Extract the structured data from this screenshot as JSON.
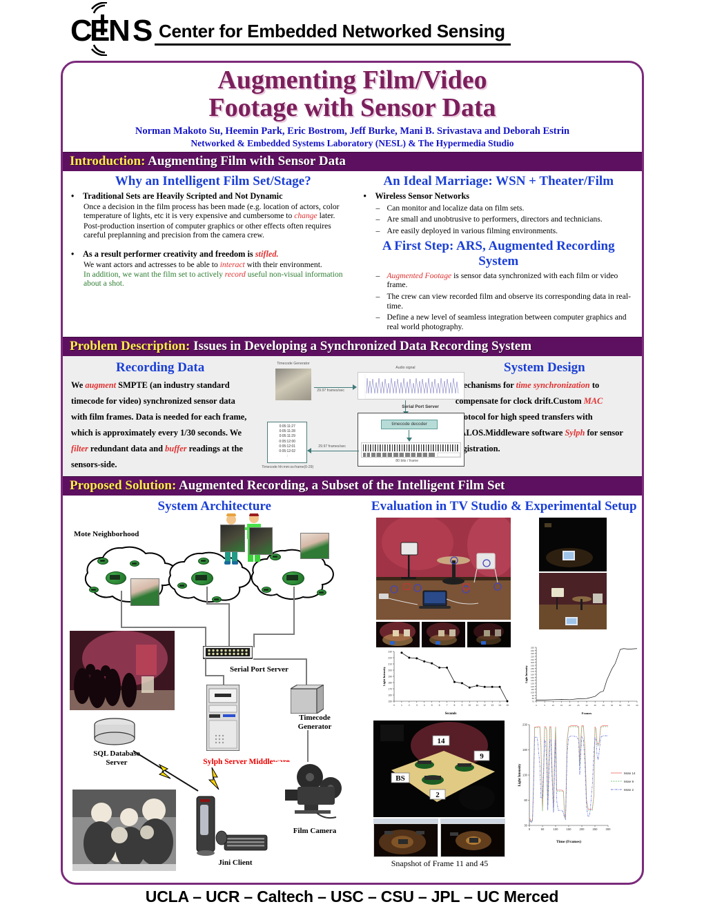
{
  "header": {
    "logo_text": "CENS",
    "title": "Center for Embedded Networked Sensing"
  },
  "poster": {
    "title_line1": "Augmenting Film/Video",
    "title_line2": "Footage with Sensor Data",
    "authors": "Norman Makoto Su, Heemin Park, Eric Bostrom, Jeff Burke, Mani B. Srivastava and Deborah Estrin",
    "affiliation": "Networked & Embedded Systems Laboratory (NESL) & The Hypermedia Studio"
  },
  "introduction": {
    "bar_key": "Introduction:",
    "bar_rest": " Augmenting Film with Sensor Data",
    "left": {
      "subhead": "Why an Intelligent Film Set/Stage?",
      "bullet1": "Traditional Sets are Heavily Scripted and Not Dynamic",
      "bullet1_p1_a": "Once a decision in the film process has been made (e.g. location of actors, color temperature of lights, etc it is very expensive and cumbersome to ",
      "bullet1_p1_em": "change",
      "bullet1_p1_b": " later.",
      "bullet1_p2": "Post-production insertion of computer graphics or other effects often requires careful preplanning and precision from the camera crew.",
      "bullet2_a": "As a result performer creativity and freedom is ",
      "bullet2_em": "stifled.",
      "bullet2_p1_a": "We want actors and actresses to be able to ",
      "bullet2_p1_em": "interact",
      "bullet2_p1_b": " with their environment.",
      "bullet2_p2_a": "In addition, we want the film set to actively ",
      "bullet2_p2_em": "record",
      "bullet2_p2_b": " useful non-visual information about a shot."
    },
    "right": {
      "subhead": "An Ideal Marriage: WSN + Theater/Film",
      "bullet": "Wireless Sensor Networks",
      "items": [
        "Can monitor and localize data on film sets.",
        "Are small and unobtrusive to performers, directors and technicians.",
        "Are easily deployed in various filming environments."
      ],
      "subhead2": "A First Step: ARS, Augmented Recording System",
      "items2_em": "Augmented Footage",
      "items2_first_rest": " is sensor data synchronized with each film or video frame.",
      "items2": [
        "The crew can view recorded film and observe its corresponding data in real-time.",
        "Define a new level of seamless integration between computer graphics and real world photography."
      ]
    }
  },
  "problem": {
    "bar_key": "Problem Description:",
    "bar_rest": " Issues in Developing a Synchronized Data Recording System",
    "left": {
      "subhead": "Recording Data",
      "t1": "We ",
      "em1": "augment",
      "t2": " SMPTE (an industry standard timecode for video) synchronized sensor data with film frames.  Data is needed for each frame, which is approximately every 1/30 seconds.  We ",
      "em2": "filter",
      "t3": " redundant data and ",
      "em3": "buffer",
      "t4": " readings at the sensors-side."
    },
    "diagram": {
      "timecode_generator": "Timecode Generator",
      "audio_signal": "Audio signal",
      "serial_port_server": "Serial Port Server",
      "timecode_decoder": "timecode decoder",
      "rate_label_top": "29.97 frames/sec",
      "rate_label_bottom": "29.97 frames/sec",
      "bits_label": "80 bits / frame",
      "codes": [
        "0:05:11:27",
        "0:05:11:28",
        "0:05:11:29",
        "0:05:12:00",
        "0:05:12:01",
        "0:05:12:02",
        ":"
      ],
      "codes_caption": "Timecode    hh:mm:ss:frame(0-29)"
    },
    "right": {
      "subhead": "System Design",
      "t1": "Mechanisms for ",
      "em1": "time synchronization",
      "t2": " to compensate for clock drift.",
      "t3": "Custom ",
      "em2": "MAC",
      "t4": " protocol for high speed transfers with PALOS.",
      "t5": "Middleware software ",
      "em3": "Sylph",
      "t6": " for sensor registration."
    }
  },
  "solution": {
    "bar_key": "Proposed Solution:",
    "bar_rest": " Augmented Recording, a Subset of the Intelligent Film Set",
    "arch_subhead": "System Architecture",
    "eval_subhead": "Evaluation in TV Studio & Experimental Setup",
    "labels": {
      "mote_neighborhood": "Mote Neighborhood",
      "serial_port_server": "Serial Port Server",
      "sql_database_server": "SQL Database\nServer",
      "sylph_server_middleware": "Sylph Server Middleware",
      "timecode_generator": "Timecode\nGenerator",
      "film_camera": "Film Camera",
      "jini_client": "Jini Client"
    },
    "photo_markers": [
      "14",
      "9",
      "BS",
      "2"
    ],
    "snapshot_caption": "Snapshot of Frame 11 and 45"
  },
  "chart_data": [
    {
      "type": "line",
      "title": "",
      "xlabel": "Seconds",
      "ylabel": "Light Intensity",
      "x": [
        1,
        2,
        3,
        4,
        5,
        6,
        7,
        8,
        9,
        10,
        11,
        12,
        13,
        14,
        15
      ],
      "values": [
        228,
        220,
        219,
        214,
        211,
        204,
        204,
        181,
        179,
        172,
        175,
        173,
        173,
        173,
        150
      ],
      "xlim": [
        0,
        15
      ],
      "ylim": [
        150,
        230
      ],
      "xticks": [
        0,
        1,
        2,
        3,
        4,
        5,
        6,
        7,
        8,
        9,
        10,
        11,
        12,
        13,
        14,
        15
      ],
      "yticks": [
        150,
        160,
        170,
        180,
        190,
        200,
        210,
        220,
        230
      ],
      "grid": false,
      "legend": "none"
    },
    {
      "type": "line",
      "title": "",
      "xlabel": "Frames",
      "ylabel": "Light Intensity",
      "x": [
        0,
        5,
        10,
        15,
        20,
        25,
        30,
        35,
        38,
        40,
        42,
        45,
        47,
        50,
        52,
        55,
        60
      ],
      "values": [
        74,
        74,
        75,
        76,
        75,
        78,
        79,
        86,
        100,
        104,
        140,
        178,
        196,
        243,
        246,
        244,
        246
      ],
      "xlim": [
        0,
        60
      ],
      "ylim": [
        70,
        250
      ],
      "xticks": [
        0,
        5,
        10,
        15,
        20,
        25,
        30,
        35,
        40,
        45,
        50,
        55,
        60
      ],
      "yticks": [
        70,
        80,
        90,
        100,
        110,
        120,
        130,
        140,
        150,
        160,
        170,
        180,
        190,
        200,
        210,
        220,
        230,
        240,
        250
      ],
      "grid": false,
      "legend": "none"
    },
    {
      "type": "line",
      "title": "",
      "xlabel": "Time (Frames)",
      "ylabel": "Light Intensity",
      "xlim": [
        0,
        300
      ],
      "ylim": [
        30,
        230
      ],
      "xticks": [
        0,
        50,
        100,
        150,
        200,
        250,
        300
      ],
      "yticks": [
        30,
        80,
        130,
        180,
        230
      ],
      "grid": false,
      "legend": "right",
      "series": [
        {
          "name": "Mote 14",
          "color": "#f08080",
          "x": [
            0,
            8,
            12,
            16,
            20,
            34,
            40,
            44,
            50,
            54,
            58,
            62,
            66,
            70,
            74,
            78,
            82,
            86,
            92,
            96,
            100,
            104,
            110,
            118,
            124,
            130,
            134,
            138,
            144,
            150,
            160,
            180,
            188,
            192,
            196,
            200,
            206,
            212,
            218,
            224,
            228,
            232,
            240,
            246,
            250,
            254,
            258,
            262,
            266,
            272,
            280,
            290,
            300
          ],
          "values": [
            45,
            38,
            40,
            120,
            225,
            226,
            226,
            190,
            60,
            120,
            226,
            226,
            220,
            70,
            150,
            226,
            226,
            150,
            60,
            170,
            226,
            100,
            100,
            100,
            100,
            98,
            50,
            45,
            200,
            226,
            228,
            228,
            226,
            150,
            200,
            228,
            228,
            180,
            80,
            62,
            62,
            62,
            62,
            90,
            226,
            222,
            195,
            190,
            195,
            226,
            228,
            228,
            228
          ]
        },
        {
          "name": "Mote 9",
          "color": "#79c47a",
          "x": [
            0,
            8,
            12,
            16,
            20,
            34,
            40,
            44,
            50,
            54,
            58,
            62,
            66,
            70,
            74,
            78,
            82,
            86,
            92,
            96,
            100,
            104,
            110,
            118,
            124,
            130,
            134,
            138,
            144,
            150,
            160,
            180,
            188,
            192,
            196,
            200,
            206,
            212,
            218,
            224,
            228,
            232,
            240,
            246,
            250,
            254,
            258,
            262,
            266,
            272,
            280,
            290,
            300
          ],
          "values": [
            42,
            36,
            40,
            118,
            224,
            224,
            224,
            188,
            58,
            118,
            224,
            224,
            218,
            68,
            148,
            224,
            224,
            148,
            58,
            168,
            224,
            98,
            98,
            98,
            98,
            96,
            48,
            43,
            198,
            224,
            226,
            226,
            224,
            148,
            198,
            226,
            226,
            178,
            78,
            60,
            60,
            60,
            60,
            88,
            224,
            220,
            193,
            188,
            193,
            224,
            226,
            226,
            226
          ]
        },
        {
          "name": "Mote 2",
          "color": "#6a73d9",
          "x": [
            0,
            8,
            12,
            16,
            20,
            30,
            40,
            44,
            50,
            54,
            58,
            62,
            66,
            70,
            74,
            78,
            82,
            86,
            92,
            96,
            100,
            104,
            110,
            118,
            124,
            130,
            134,
            138,
            144,
            150,
            160,
            180,
            188,
            192,
            196,
            200,
            206,
            212,
            218,
            224,
            228,
            232,
            240,
            246,
            250,
            254,
            258,
            262,
            266,
            272,
            280,
            290,
            300
          ],
          "values": [
            40,
            36,
            40,
            110,
            205,
            205,
            150,
            85,
            85,
            140,
            200,
            195,
            150,
            60,
            120,
            200,
            200,
            130,
            55,
            140,
            200,
            80,
            60,
            60,
            60,
            55,
            45,
            42,
            175,
            205,
            208,
            206,
            200,
            130,
            175,
            206,
            200,
            150,
            65,
            48,
            48,
            60,
            110,
            175,
            205,
            200,
            170,
            160,
            175,
            205,
            208,
            208,
            208
          ]
        }
      ]
    }
  ],
  "footer": {
    "text": "UCLA – UCR – Caltech – USC – CSU – JPL – UC Merced"
  }
}
